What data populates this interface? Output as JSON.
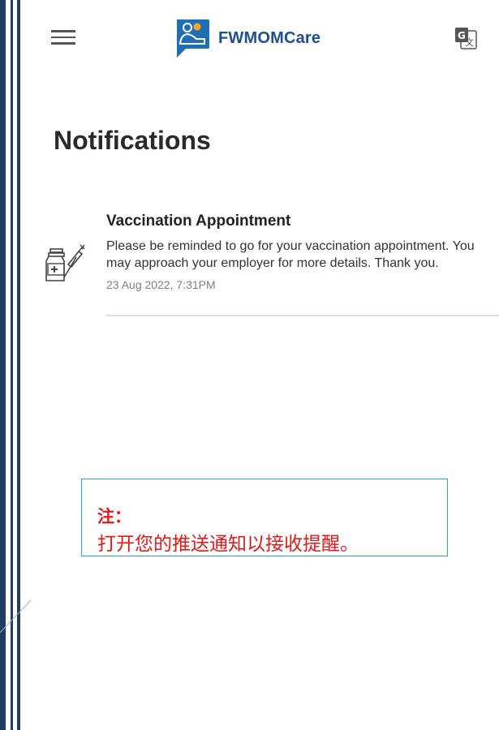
{
  "header": {
    "app_name": "FWMOMCare",
    "menu_icon": "hamburger-menu-icon",
    "translate_icon": "google-translate-icon",
    "brand_color": "#1c4f93"
  },
  "page": {
    "title": "Notifications"
  },
  "notifications": [
    {
      "icon": "vaccine-icon",
      "title": "Vaccination Appointment",
      "body": "Please be reminded to go for your vaccination appointment. You may approach your employer for more details. Thank you.",
      "time": "23 Aug 2022, 7:31PM"
    }
  ],
  "note": {
    "label": "注：",
    "text": "打开您的推送通知以接收提醒。",
    "color": "#e01a1a",
    "border_color": "#28a6dc"
  }
}
